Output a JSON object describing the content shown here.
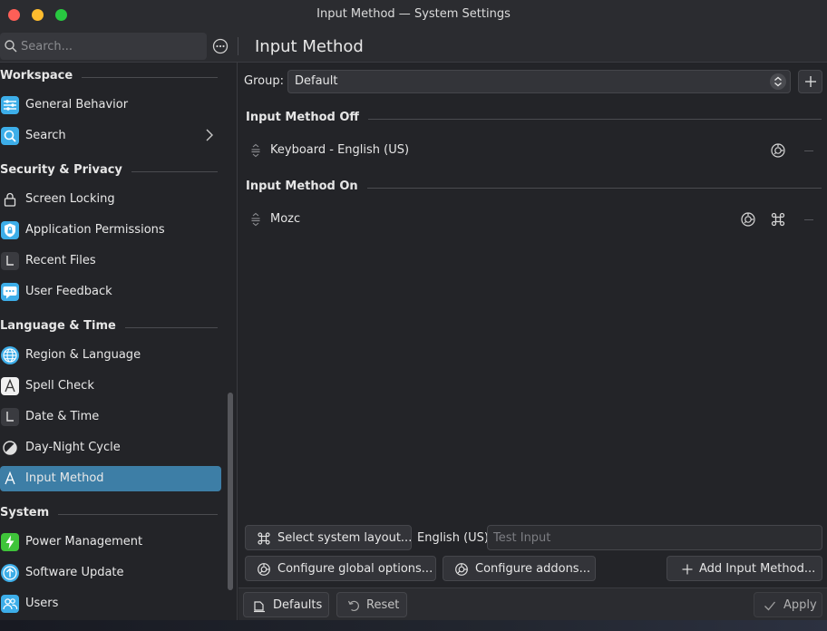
{
  "window": {
    "title": "Input Method — System Settings"
  },
  "header": {
    "search_placeholder": "Search...",
    "page_title": "Input Method"
  },
  "sidebar": {
    "categories": [
      {
        "label": "Workspace",
        "items": [
          {
            "label": "General Behavior",
            "icon": "sliders-icon",
            "color": "#3daee9"
          },
          {
            "label": "Search",
            "icon": "search-icon",
            "color": "#3daee9",
            "has_submenu": true
          }
        ]
      },
      {
        "label": "Security & Privacy",
        "items": [
          {
            "label": "Screen Locking",
            "icon": "lock-icon"
          },
          {
            "label": "Application Permissions",
            "icon": "shield-icon",
            "color": "#3daee9"
          },
          {
            "label": "Recent Files",
            "icon": "recent-files-icon"
          },
          {
            "label": "User Feedback",
            "icon": "feedback-icon",
            "color": "#3daee9"
          }
        ]
      },
      {
        "label": "Language & Time",
        "items": [
          {
            "label": "Region & Language",
            "icon": "globe-icon",
            "color": "#3daee9"
          },
          {
            "label": "Spell Check",
            "icon": "spell-check-icon"
          },
          {
            "label": "Date & Time",
            "icon": "clock-icon"
          },
          {
            "label": "Day-Night Cycle",
            "icon": "day-night-icon"
          },
          {
            "label": "Input Method",
            "icon": "input-method-icon",
            "active": true
          }
        ]
      },
      {
        "label": "System",
        "items": [
          {
            "label": "Power Management",
            "icon": "power-icon",
            "color": "#3fc43a"
          },
          {
            "label": "Software Update",
            "icon": "update-icon",
            "color": "#3daee9"
          },
          {
            "label": "Users",
            "icon": "users-icon",
            "color": "#3daee9"
          }
        ]
      }
    ]
  },
  "main": {
    "group_label": "Group:",
    "group_value": "Default",
    "off_section": "Input Method Off",
    "off_items": [
      {
        "name": "Keyboard - English (US)"
      }
    ],
    "on_section": "Input Method On",
    "on_items": [
      {
        "name": "Mozc"
      }
    ],
    "select_layout_label": "Select system layout...",
    "layout_value": "English (US)",
    "test_input_placeholder": "Test Input",
    "configure_global_label": "Configure global options...",
    "configure_addons_label": "Configure addons...",
    "add_input_method_label": "Add Input Method..."
  },
  "footer": {
    "defaults_label": "Defaults",
    "reset_label": "Reset",
    "apply_label": "Apply"
  },
  "colors": {
    "accent": "#3d7ea6",
    "background": "#232428"
  }
}
